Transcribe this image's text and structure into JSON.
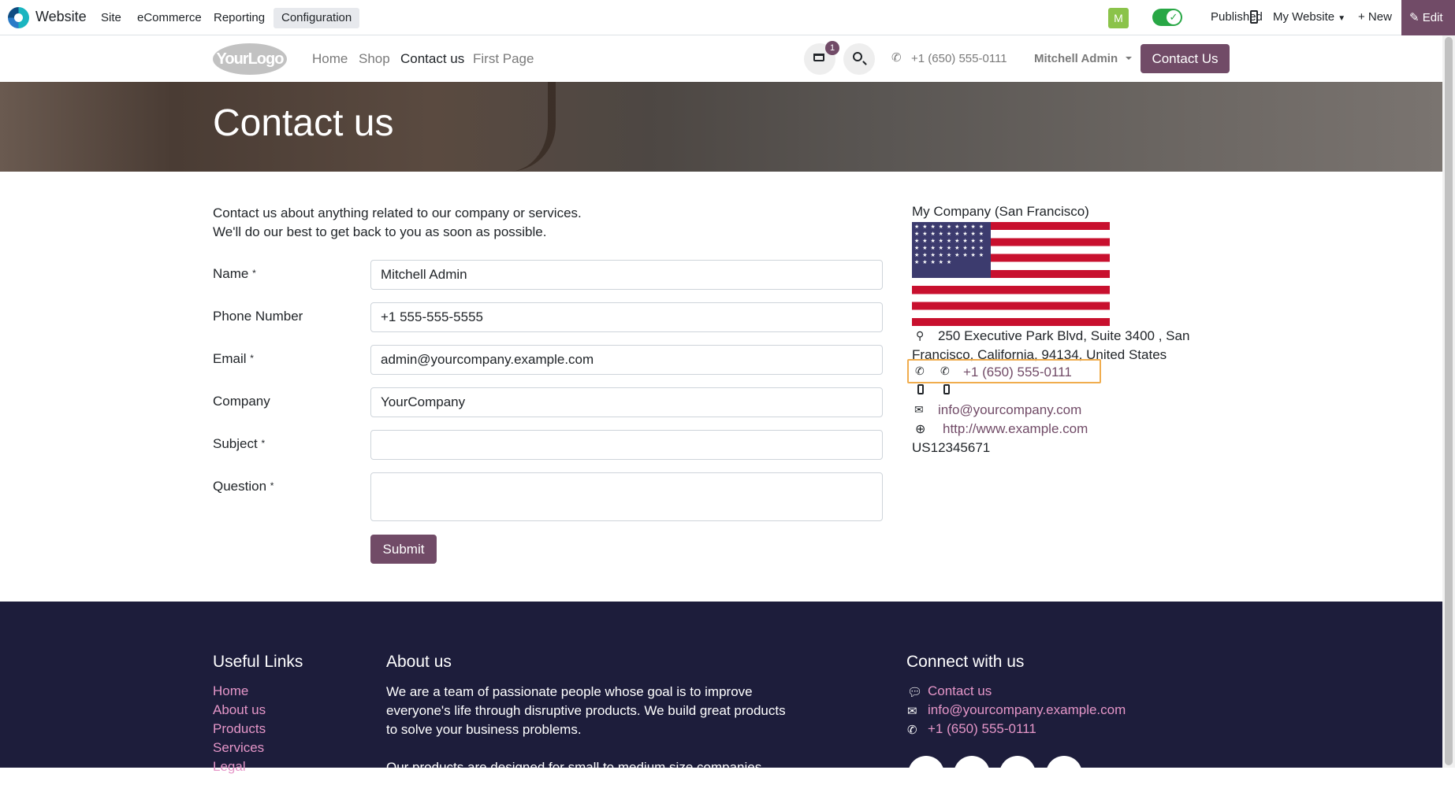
{
  "adminbar": {
    "app_name": "Website",
    "menus": [
      "Site",
      "eCommerce",
      "Reporting",
      "Configuration"
    ],
    "avatar_letter": "M",
    "published_label": "Published",
    "my_website_label": "My Website",
    "new_label": "+ New",
    "edit_label": "✎ Edit"
  },
  "header": {
    "logo_text": "YourLogo",
    "nav": [
      "Home",
      "Shop",
      "Contact us",
      "First Page"
    ],
    "cart_count": "1",
    "phone": "+1 (650) 555-0111",
    "user": "Mitchell Admin",
    "cta": "Contact Us"
  },
  "banner": {
    "title": "Contact us"
  },
  "intro": {
    "line1": "Contact us about anything related to our company or services.",
    "line2": "We'll do our best to get back to you as soon as possible."
  },
  "form": {
    "fields": [
      {
        "label": "Name",
        "required": true,
        "value": "Mitchell Admin"
      },
      {
        "label": "Phone Number",
        "required": false,
        "value": "+1 555-555-5555"
      },
      {
        "label": "Email",
        "required": true,
        "value": "admin@yourcompany.example.com"
      },
      {
        "label": "Company",
        "required": false,
        "value": "YourCompany"
      },
      {
        "label": "Subject",
        "required": true,
        "value": ""
      },
      {
        "label": "Question",
        "required": true,
        "value": ""
      }
    ],
    "required_mark": "*",
    "submit_label": "Submit"
  },
  "company": {
    "name": "My Company (San Francisco)",
    "flag_stars": "★ ★ ★ ★ ★ ★ ★ ★ ★ ★ ★ ★ ★ ★ ★ ★ ★ ★ ★ ★ ★ ★ ★ ★ ★ ★ ★ ★ ★ ★ ★ ★ ★ ★ ★ ★ ★ ★ ★ ★ ★ ★ ★ ★ ★ ★ ★ ★ ★ ★",
    "address": "250 Executive Park Blvd, Suite 3400 , San Francisco, California, 94134, United States",
    "phone": "+1 (650) 555-0111",
    "email": "info@yourcompany.com",
    "website": "http://www.example.com",
    "vat": "US12345671"
  },
  "footer": {
    "useful_links_title": "Useful Links",
    "useful_links": [
      "Home",
      "About us",
      "Products",
      "Services",
      "Legal"
    ],
    "about_title": "About us",
    "about_text": "We are a team of passionate people whose goal is to improve everyone's life through disruptive products. We build great products to solve your business problems.",
    "about_text2": "Our products are designed for small to medium size companies willing to",
    "connect_title": "Connect with us",
    "connect_contact": "Contact us",
    "connect_email": "info@yourcompany.example.com",
    "connect_phone": "+1 (650) 555-0111"
  },
  "colors": {
    "brand": "#714b67",
    "footer_bg": "#1d1d3b",
    "footer_link": "#e596c8",
    "highlight": "#f0ad4e",
    "published": "#28a745"
  }
}
